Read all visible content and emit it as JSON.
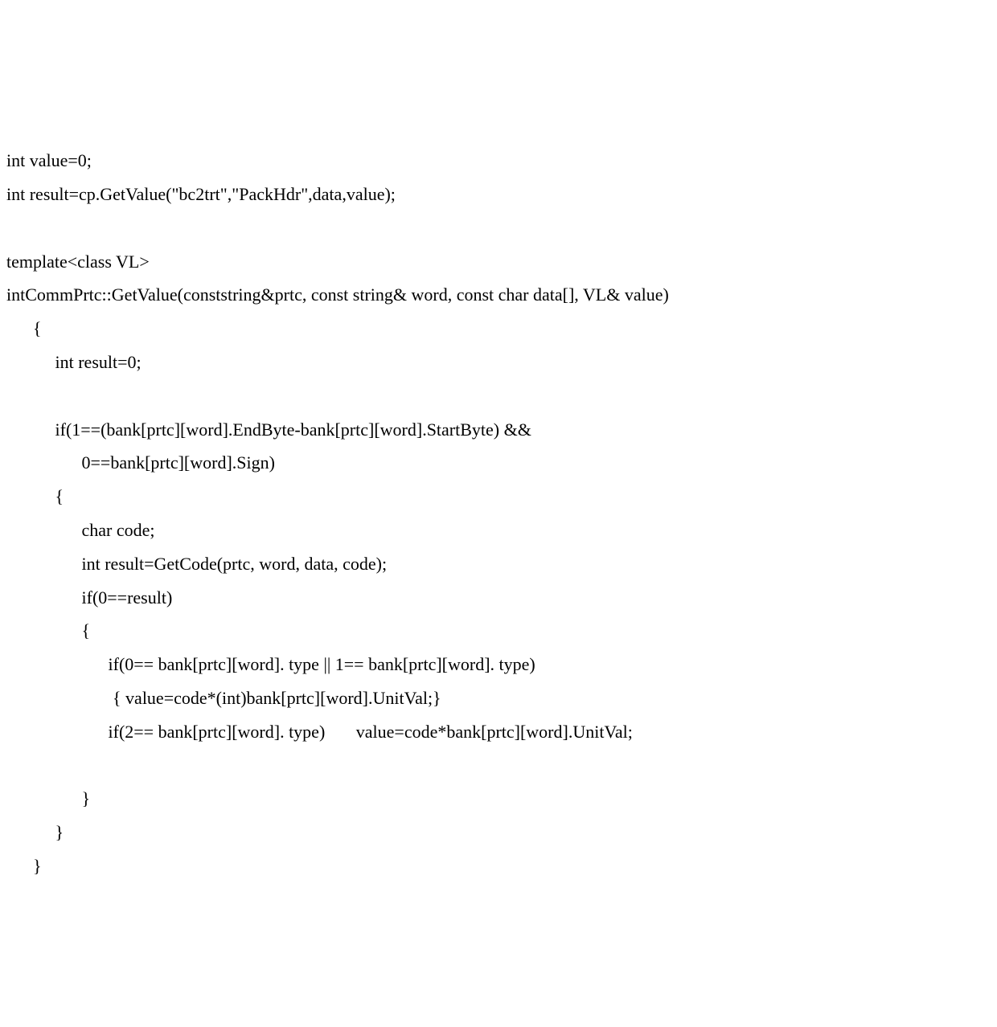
{
  "code": {
    "l01": "int value=0;",
    "l02": "int result=cp.GetValue(\"bc2trt\",\"PackHdr\",data,value);",
    "l03": "",
    "l04": "template<class VL>",
    "l05": "intCommPrtc::GetValue(conststring&prtc, const string& word, const char data[], VL& value)",
    "l06": "      {",
    "l07": "           int result=0;",
    "l08": "",
    "l09": "           if(1==(bank[prtc][word].EndByte-bank[prtc][word].StartByte) &&",
    "l10": "                 0==bank[prtc][word].Sign)",
    "l11": "           {",
    "l12": "                 char code;",
    "l13": "                 int result=GetCode(prtc, word, data, code);",
    "l14": "                 if(0==result)",
    "l15": "                 {",
    "l16": "                       if(0== bank[prtc][word]. type || 1== bank[prtc][word]. type)",
    "l17": "                        { value=code*(int)bank[prtc][word].UnitVal;}",
    "l18": "                       if(2== bank[prtc][word]. type)       value=code*bank[prtc][word].UnitVal;",
    "l19": "",
    "l20": "                 }",
    "l21": "           }",
    "l22": "      }"
  }
}
